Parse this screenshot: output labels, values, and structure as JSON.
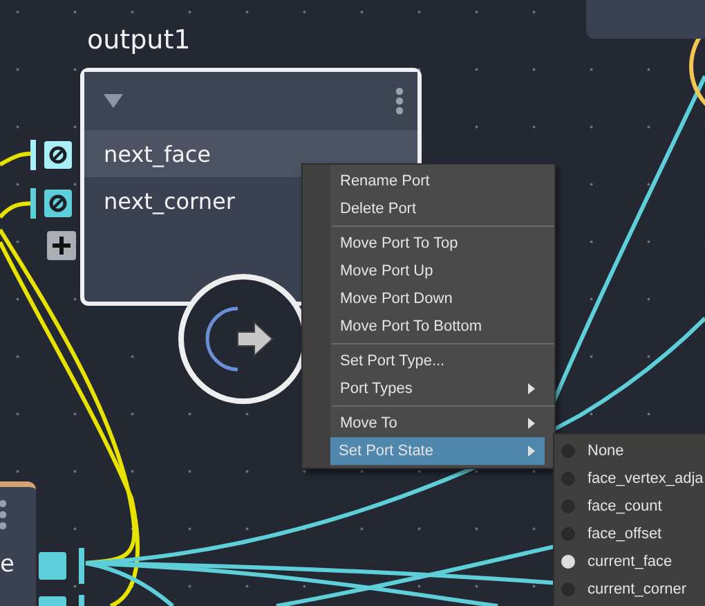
{
  "node": {
    "title": "output1",
    "expanded": true,
    "ports": [
      {
        "name": "next_face",
        "selected": true
      },
      {
        "name": "next_corner",
        "selected": false
      }
    ]
  },
  "partial_node": {
    "label": "e"
  },
  "context_menu": {
    "items": [
      {
        "kind": "item",
        "label": "Rename Port",
        "submenu": false,
        "selected": false
      },
      {
        "kind": "item",
        "label": "Delete Port",
        "submenu": false,
        "selected": false
      },
      {
        "kind": "separator"
      },
      {
        "kind": "item",
        "label": "Move Port To Top",
        "submenu": false,
        "selected": false
      },
      {
        "kind": "item",
        "label": "Move Port Up",
        "submenu": false,
        "selected": false
      },
      {
        "kind": "item",
        "label": "Move Port Down",
        "submenu": false,
        "selected": false
      },
      {
        "kind": "item",
        "label": "Move Port To Bottom",
        "submenu": false,
        "selected": false
      },
      {
        "kind": "separator"
      },
      {
        "kind": "item",
        "label": "Set Port Type...",
        "submenu": false,
        "selected": false
      },
      {
        "kind": "item",
        "label": "Port Types",
        "submenu": true,
        "selected": false
      },
      {
        "kind": "separator"
      },
      {
        "kind": "item",
        "label": "Move To",
        "submenu": true,
        "selected": false
      },
      {
        "kind": "item",
        "label": "Set Port State",
        "submenu": true,
        "selected": true
      }
    ]
  },
  "submenu": {
    "items": [
      {
        "label": "None",
        "checked": false
      },
      {
        "label": "face_vertex_adja",
        "checked": false
      },
      {
        "label": "face_count",
        "checked": false
      },
      {
        "label": "face_offset",
        "checked": false
      },
      {
        "label": "current_face",
        "checked": true
      },
      {
        "label": "current_corner",
        "checked": false
      }
    ]
  }
}
